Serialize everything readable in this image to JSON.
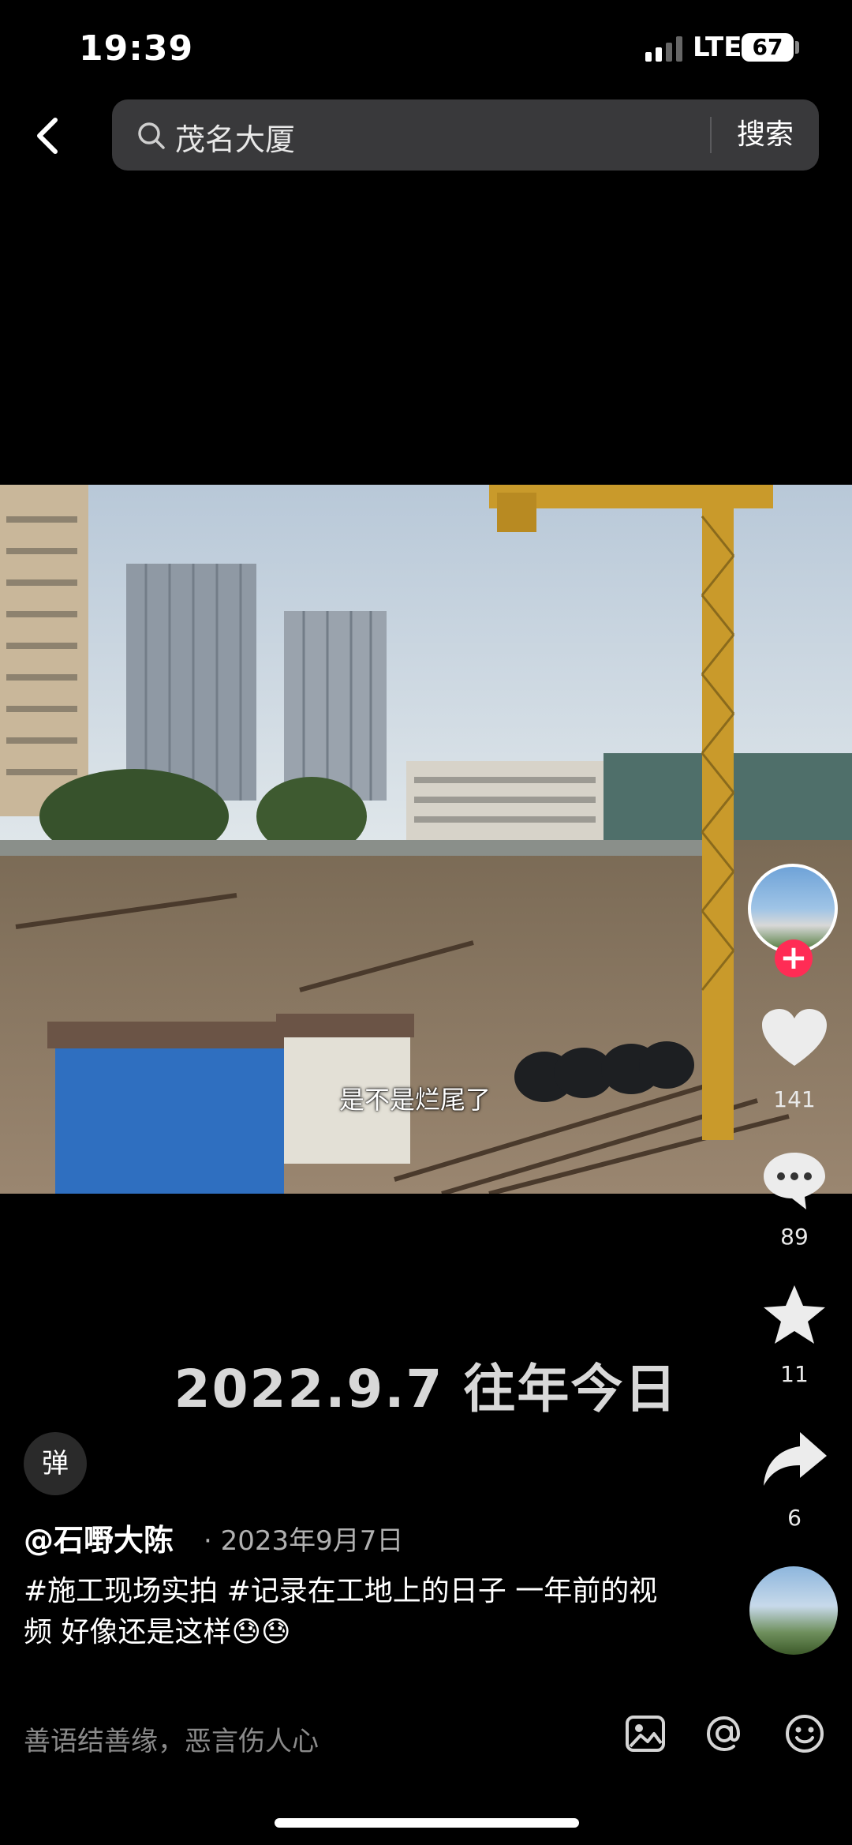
{
  "status_bar": {
    "time": "19:39",
    "network": "LTE",
    "battery": "67"
  },
  "search": {
    "query": "茂名大厦",
    "button_label": "搜索"
  },
  "video": {
    "subtitle": "是不是烂尾了",
    "date_overlay": "2022.9.7 往年今日"
  },
  "actions": {
    "like_count": "141",
    "comment_count": "89",
    "favorite_count": "11",
    "share_count": "6",
    "follow_symbol": "+"
  },
  "post": {
    "danmaku_label": "弹",
    "author": "@石嘢大陈",
    "date": "· 2023年9月7日",
    "caption": "#施工现场实拍 #记录在工地上的日子 一年前的视频 好像还是这样😓😓"
  },
  "comment_bar": {
    "placeholder": "善语结善缘，恶言伤人心"
  },
  "icons": [
    "back-icon",
    "search-icon",
    "heart-icon",
    "comment-icon",
    "star-icon",
    "share-icon",
    "image-icon",
    "at-icon",
    "emoji-icon"
  ],
  "colors": {
    "accent": "#ff2c55",
    "background": "#000000",
    "search_box": "#39393b"
  }
}
